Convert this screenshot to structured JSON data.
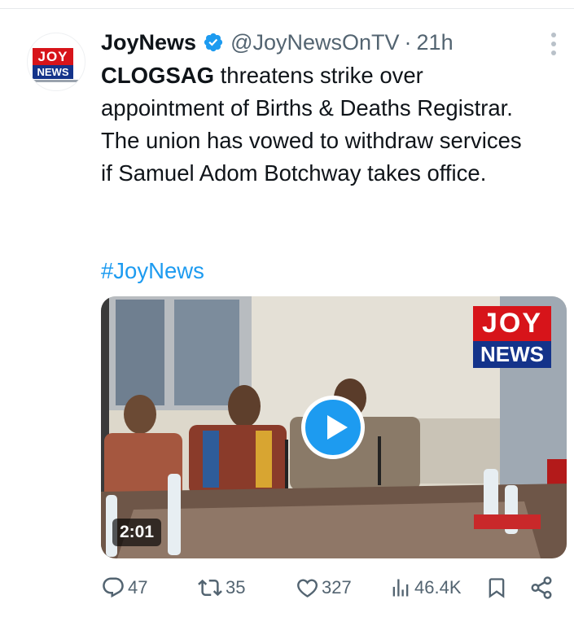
{
  "tweet": {
    "author_name": "JoyNews",
    "handle": "@JoyNewsOnTV",
    "separator": "·",
    "time": "21h",
    "text_bold": "CLOGSAG",
    "text_rest": " threatens strike over appointment of Births & Deaths Registrar. The union has vowed to withdraw services if Samuel Adom Botchway takes office.",
    "hashtag": "#JoyNews"
  },
  "avatar": {
    "logo_top": "JOY",
    "logo_bottom": "NEWS"
  },
  "media": {
    "duration": "2:01",
    "watermark_top": "JOY",
    "watermark_bottom": "NEWS"
  },
  "actions": {
    "replies": "47",
    "reposts": "35",
    "likes": "327",
    "views": "46.4K"
  },
  "colors": {
    "accent": "#1d9bf0",
    "secondary_text": "#536471",
    "brand_red": "#d7141a",
    "brand_blue": "#14338a"
  },
  "icons": [
    "verified-badge-icon",
    "more-options-icon",
    "play-icon",
    "reply-icon",
    "repost-icon",
    "like-icon",
    "views-icon",
    "bookmark-icon",
    "share-icon"
  ]
}
